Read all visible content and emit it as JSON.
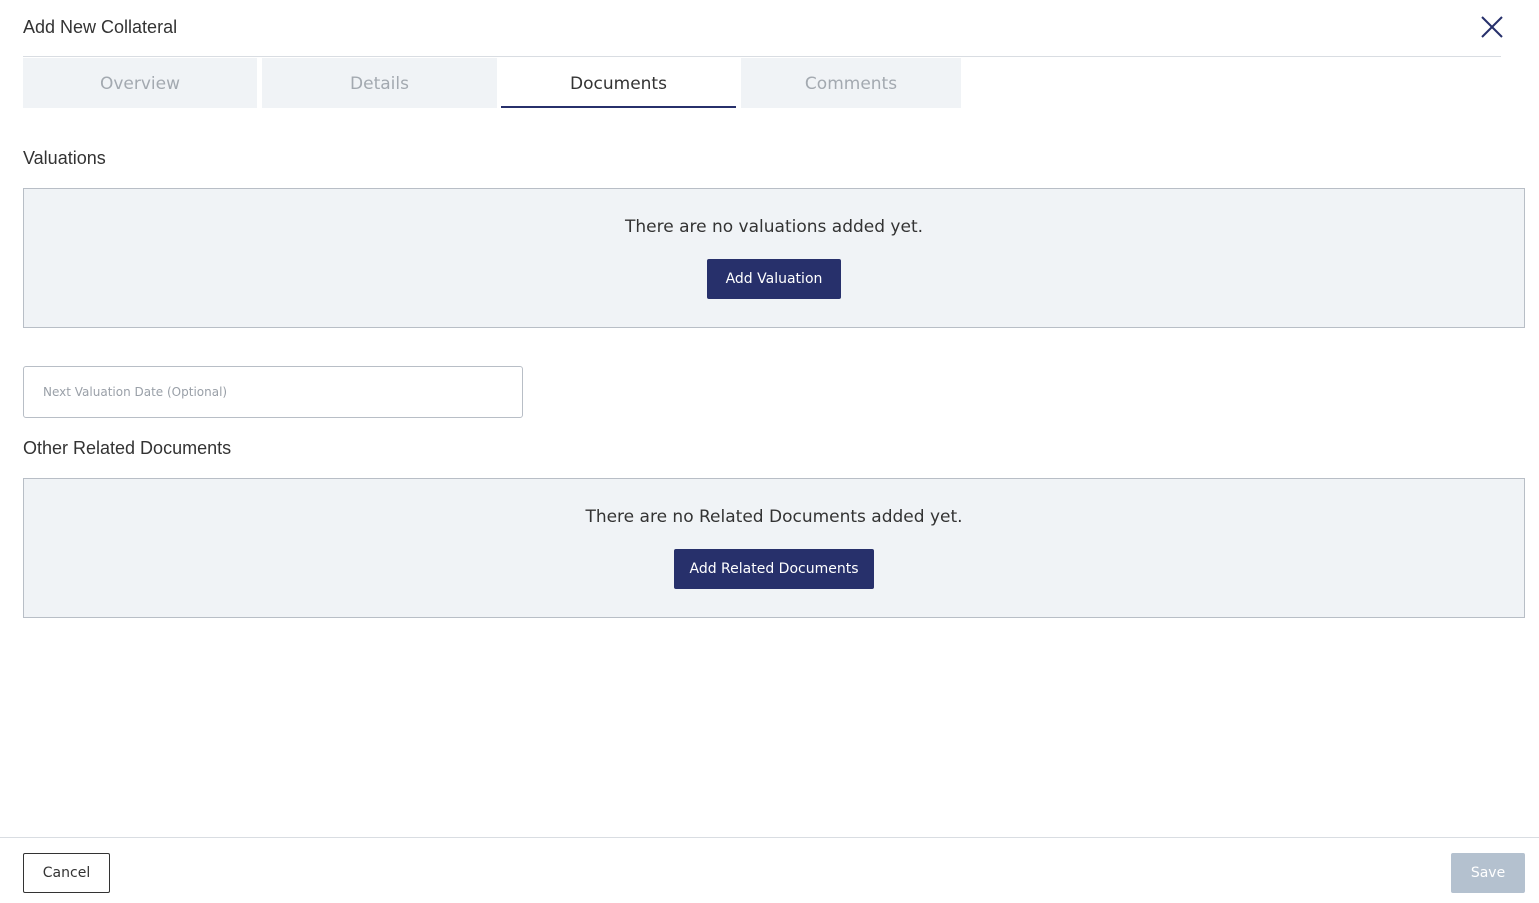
{
  "header": {
    "title": "Add New Collateral",
    "close_icon": "close-icon"
  },
  "tabs": [
    {
      "label": "Overview",
      "active": false
    },
    {
      "label": "Details",
      "active": false
    },
    {
      "label": "Documents",
      "active": true
    },
    {
      "label": "Comments",
      "active": false
    }
  ],
  "valuations": {
    "title": "Valuations",
    "empty_message": "There are no valuations added yet.",
    "add_button": "Add Valuation"
  },
  "next_valuation_date": {
    "placeholder": "Next Valuation Date (Optional)",
    "value": ""
  },
  "related_documents": {
    "title": "Other Related Documents",
    "empty_message": "There are no Related Documents added yet.",
    "add_button": "Add Related Documents"
  },
  "footer": {
    "cancel_label": "Cancel",
    "save_label": "Save",
    "save_enabled": false
  },
  "colors": {
    "primary": "#27306b",
    "panel_bg": "#f0f3f6",
    "disabled_button": "#b4c1cf"
  }
}
